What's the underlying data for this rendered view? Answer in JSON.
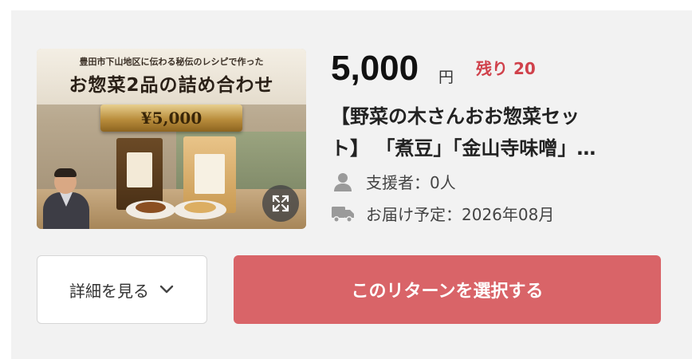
{
  "thumbnail": {
    "subline": "豊田市下山地区に伝わる秘伝のレシピで作った",
    "headline": "お惣菜2品の詰め合わせ",
    "price_ribbon": "¥5,000",
    "expand_icon": "expand-icon"
  },
  "price": {
    "amount": "5,000",
    "unit": "円"
  },
  "remaining": "残り 20",
  "title_lines": [
    "【野菜の木さんおお惣菜セッ",
    "ト】 「煮豆」「金山寺味噌」…"
  ],
  "meta": {
    "supporters_label": "支援者：0人",
    "supporters_icon": "person-icon",
    "delivery_label": "お届け予定：2026年08月",
    "delivery_icon": "truck-icon"
  },
  "buttons": {
    "detail_label": "詳細を見る",
    "detail_icon": "chevron-down-icon",
    "select_label": "このリターンを選択する"
  },
  "colors": {
    "accent": "#d96468",
    "remaining": "#d0414b",
    "card_bg": "#f2f2f2"
  }
}
